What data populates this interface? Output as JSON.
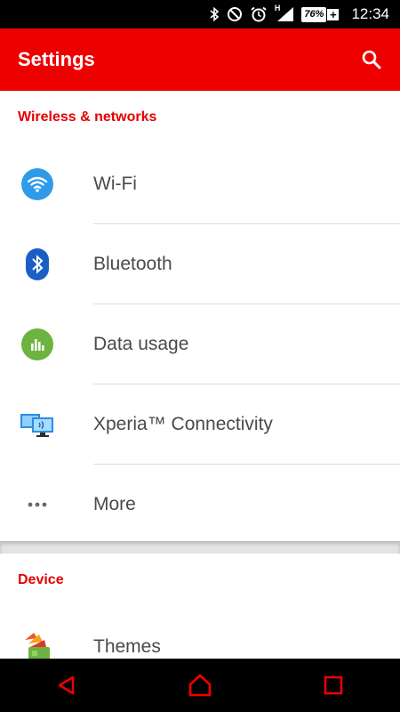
{
  "status_bar": {
    "time": "12:34",
    "battery_percent": "76%",
    "network_type": "H",
    "icons": [
      "bluetooth-icon",
      "do-not-disturb-icon",
      "alarm-icon",
      "signal-icon",
      "battery-icon",
      "charging-icon"
    ]
  },
  "app_bar": {
    "title": "Settings",
    "search_icon": "search-icon"
  },
  "sections": [
    {
      "header": "Wireless & networks",
      "items": [
        {
          "label": "Wi-Fi",
          "icon": "wifi-icon",
          "color": "#2f9be8"
        },
        {
          "label": "Bluetooth",
          "icon": "bluetooth-icon",
          "color": "#1c5fc4"
        },
        {
          "label": "Data usage",
          "icon": "data-usage-icon",
          "color": "#6db33f"
        },
        {
          "label": "Xperia™ Connectivity",
          "icon": "xperia-connectivity-icon",
          "color": "#2b8de0"
        },
        {
          "label": "More",
          "icon": "more-icon",
          "color": "#6a6a6a"
        }
      ]
    },
    {
      "header": "Device",
      "items": [
        {
          "label": "Themes",
          "icon": "themes-icon",
          "color": "#f05a28"
        }
      ]
    }
  ],
  "nav_bar": {
    "back": "back-icon",
    "home": "home-icon",
    "recents": "recents-icon",
    "color": "#ee0000"
  },
  "colors": {
    "accent": "#ee0000",
    "section_header": "#e40000",
    "text": "#4a4a4a"
  }
}
